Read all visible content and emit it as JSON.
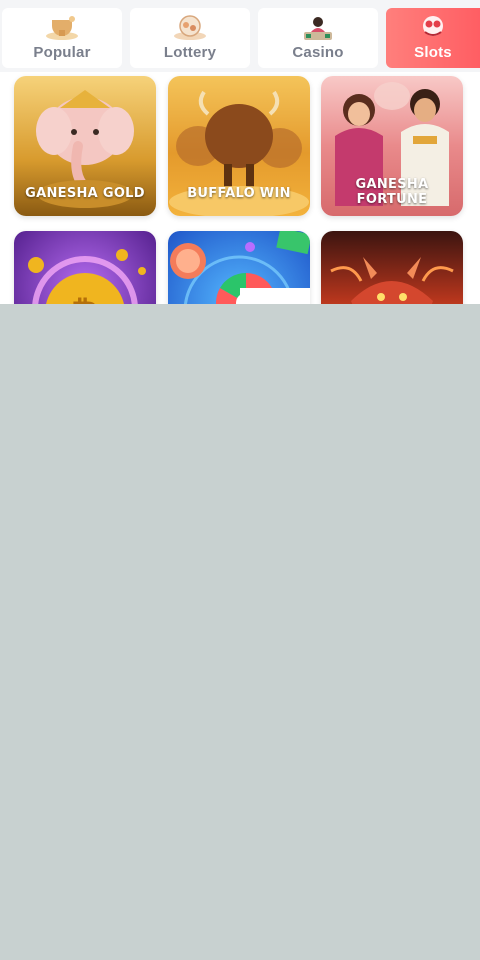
{
  "tabs": [
    {
      "label": "Popular",
      "icon": "trophy-icon",
      "active": false
    },
    {
      "label": "Lottery",
      "icon": "lottery-balls-icon",
      "active": false
    },
    {
      "label": "Casino",
      "icon": "casino-dealer-icon",
      "active": false
    },
    {
      "label": "Slots",
      "icon": "slots-icon",
      "active": true
    }
  ],
  "games": [
    {
      "title": "GANESHA GOLD"
    },
    {
      "title": "BUFFALO WIN"
    },
    {
      "title_line1": "GANESHA",
      "title_line2": "FORTUNE"
    },
    {
      "title": ""
    },
    {
      "title": ""
    },
    {
      "title": ""
    }
  ],
  "colors": {
    "active_tab_start": "#ff7f7c",
    "active_tab_end": "#ff5e63",
    "tab_text": "#7a7f8c",
    "lower_background": "#c8d1d0"
  }
}
